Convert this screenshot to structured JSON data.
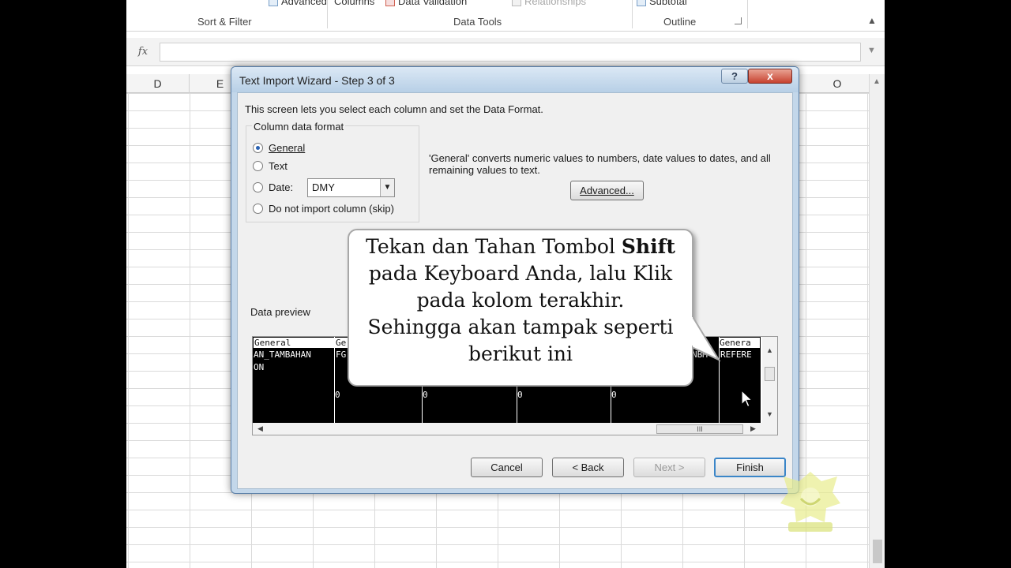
{
  "ribbon": {
    "groups": {
      "sort_filter": "Sort & Filter",
      "data_tools": "Data Tools",
      "outline": "Outline"
    },
    "partial_items": {
      "advanced": "Advanced",
      "columns": "Columns",
      "data_validation": "Data Validation",
      "relationships": "Relationships",
      "subtotal": "Subtotal"
    }
  },
  "formula_bar": {
    "fx": "fx",
    "value": ""
  },
  "columns": [
    "D",
    "E",
    "O"
  ],
  "dialog": {
    "title": "Text Import Wizard - Step 3 of 3",
    "help_label": "?",
    "close_label": "x",
    "intro": "This screen lets you select each column and set the Data Format.",
    "column_format": {
      "legend": "Column data format",
      "options": [
        "General",
        "Text",
        "Date:",
        "Do not import column (skip)"
      ],
      "selected": "General",
      "date_value": "DMY"
    },
    "description": "'General' converts numeric values to numbers, date values to dates, and all remaining values to text.",
    "advanced_button": "Advanced...",
    "preview_label": "Data preview",
    "preview": {
      "headers": [
        "General",
        "Ge",
        "Genera"
      ],
      "cells": [
        "AN_TAMBAHAN",
        "ON",
        "FG",
        "0",
        "0",
        "0",
        "0",
        "NBM",
        "REFERE"
      ],
      "hscroll_grip": "III"
    },
    "buttons": {
      "cancel": "Cancel",
      "back": "< Back",
      "next": "Next >",
      "finish": "Finish"
    }
  },
  "callout": {
    "line1_prefix": "Tekan dan Tahan Tombol ",
    "line1_bold": "Shift",
    "line2": "pada Keyboard Anda, lalu Klik",
    "line3": "pada kolom terakhir.",
    "line4": "Sehingga akan tampak seperti",
    "line5": "berikut ini"
  }
}
